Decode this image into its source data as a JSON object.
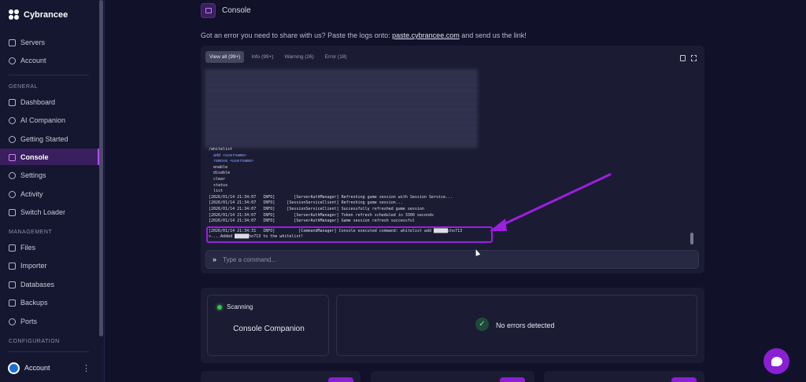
{
  "brand": {
    "name": "Cybrancee"
  },
  "sidebar": {
    "top_items": [
      {
        "label": "Servers",
        "icon": "server-icon"
      },
      {
        "label": "Account",
        "icon": "user-icon"
      }
    ],
    "sections": {
      "general": "GENERAL",
      "management": "MANAGEMENT",
      "configuration": "CONFIGURATION"
    },
    "general_items": [
      {
        "label": "Dashboard",
        "icon": "grid-icon"
      },
      {
        "label": "AI Companion",
        "icon": "sparkle-icon"
      },
      {
        "label": "Getting Started",
        "icon": "rocket-icon"
      },
      {
        "label": "Console",
        "icon": "terminal-icon"
      },
      {
        "label": "Settings",
        "icon": "gear-icon"
      },
      {
        "label": "Activity",
        "icon": "eye-icon"
      },
      {
        "label": "Switch Loader",
        "icon": "swap-icon"
      }
    ],
    "management_items": [
      {
        "label": "Files",
        "icon": "file-icon"
      },
      {
        "label": "Importer",
        "icon": "import-icon"
      },
      {
        "label": "Databases",
        "icon": "database-icon"
      },
      {
        "label": "Backups",
        "icon": "archive-icon"
      },
      {
        "label": "Ports",
        "icon": "port-icon"
      }
    ],
    "account_label": "Account"
  },
  "page": {
    "title": "Console",
    "info_prefix": "Got an error you need to share with us? Paste the logs onto: ",
    "info_link": "paste.cybrancee.com",
    "info_suffix": " and send us the link!"
  },
  "console": {
    "tabs": [
      "View all (99+)",
      "Info (99+)",
      "Warning (26)",
      "Error (18)"
    ],
    "active_tab": 0,
    "lines": [
      "/whitelist",
      "  add <username>",
      "  remove <username>",
      "  enable",
      "  disable",
      "  clear",
      "  status",
      "  list",
      "[2026/01/14 21:34:07   INFO]        [ServerAuthManager] Refreshing game session with Session Service...",
      "[2026/01/14 21:34:07   INFO]     [SessionServiceClient] Refreshing game session...",
      "[2026/01/14 21:34:07   INFO]     [SessionServiceClient] Successfully refreshed game session",
      "[2026/01/14 21:34:07   INFO]        [ServerAuthManager] Token refresh scheduled in 3300 seconds",
      "[2026/01/14 21:34:07   INFO]        [ServerAuthManager] Game session refresh successful",
      "[2026/01/14 21:34:31   INFO]          [CommandManager] Console executed command: whitelist add ██████cho713",
      ">....Added ██████ho713 to the whitelist!"
    ],
    "input_placeholder": "Type a command..."
  },
  "companion": {
    "status": "Scanning",
    "title": "Console Companion",
    "result": "No errors detected"
  },
  "colors": {
    "accent": "#9b1fe0",
    "active_bg": "#3a1f5e",
    "ok": "#36c14a"
  }
}
